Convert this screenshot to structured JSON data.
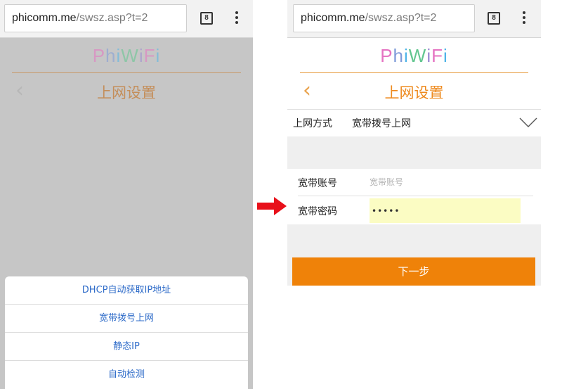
{
  "left_phone": {
    "url": {
      "host": "phicomm.me",
      "path": "/swsz.asp?t=2"
    },
    "tab_count": "8",
    "logo": "PhiWiFi",
    "title": "上网设置",
    "sheet_options": [
      {
        "label": "DHCP自动获取IP地址"
      },
      {
        "label": "宽带拨号上网"
      },
      {
        "label": "静态IP"
      },
      {
        "label": "自动检测"
      }
    ]
  },
  "right_phone": {
    "url": {
      "host": "phicomm.me",
      "path": "/swsz.asp?t=2"
    },
    "tab_count": "8",
    "logo": "PhiWiFi",
    "title": "上网设置",
    "connection_mode": {
      "label": "上网方式",
      "value": "宽带拨号上网"
    },
    "account": {
      "label": "宽带账号",
      "placeholder": "宽带账号",
      "value": ""
    },
    "password": {
      "label": "宽带密码",
      "value": "•••••"
    },
    "next_button": "下一步"
  },
  "colors": {
    "accent_orange": "#ef8209",
    "title_orange": "#ee8a1e",
    "arrow_red": "#e8101a",
    "sheet_link_blue": "#2f6cc9",
    "password_field_yellow": "#fbfcc3"
  },
  "icons": [
    "back-chevron-icon",
    "tabs-counter-icon",
    "overflow-menu-icon",
    "dropdown-chevron-icon",
    "red-arrow-icon"
  ]
}
